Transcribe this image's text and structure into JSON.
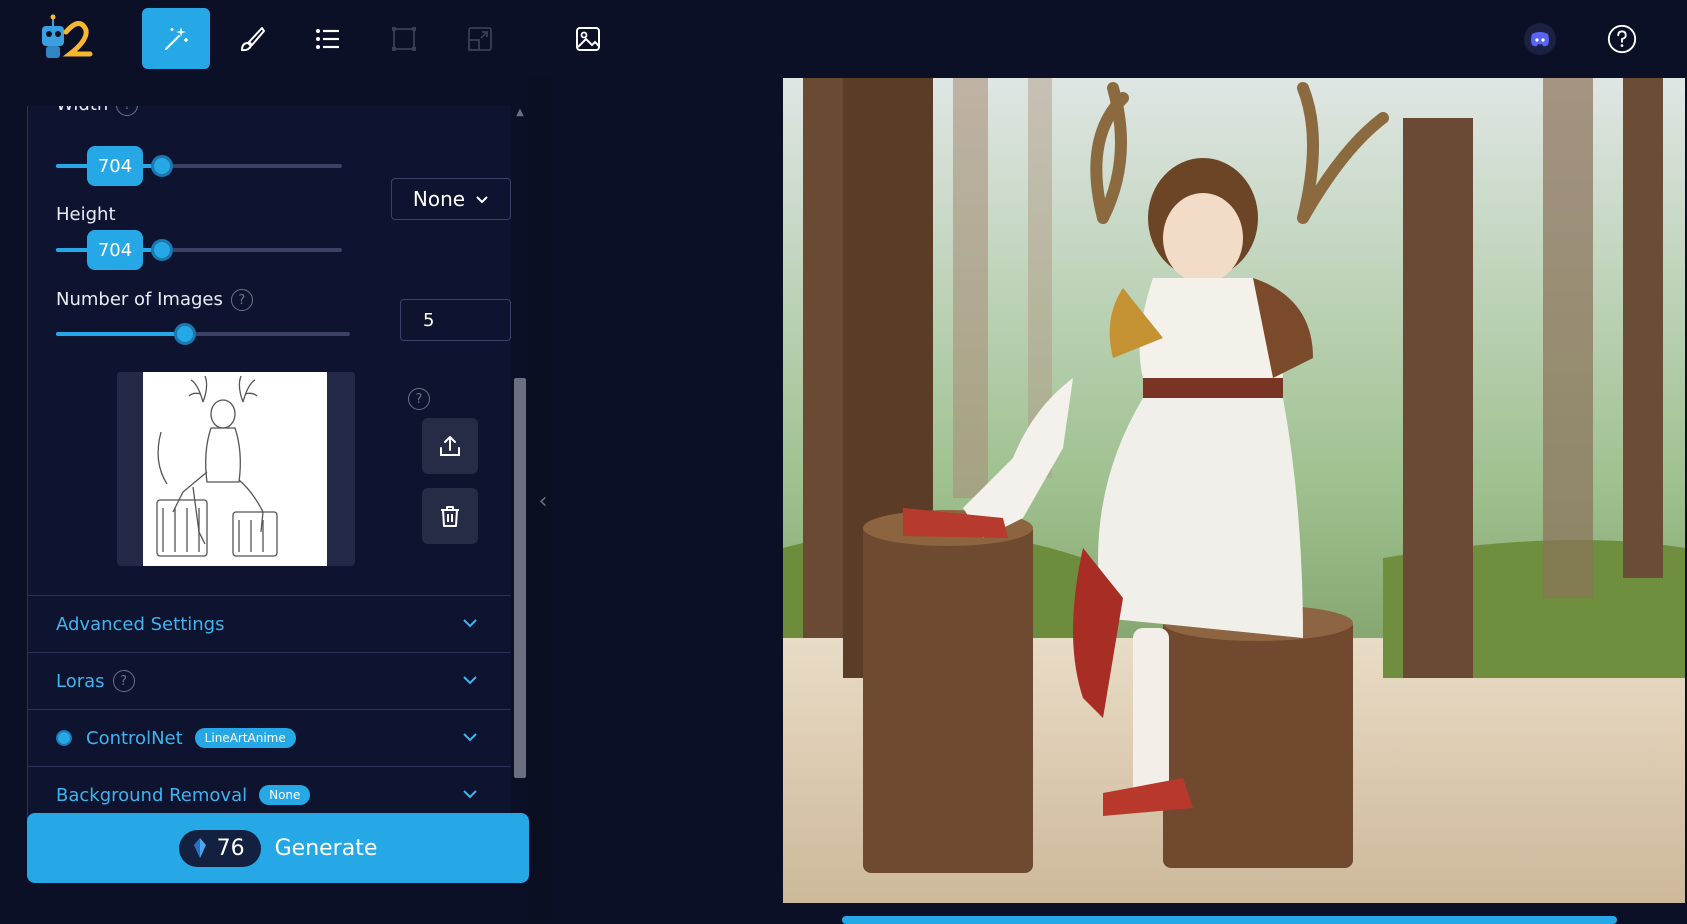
{
  "toolbar": {
    "tools": [
      {
        "name": "generate",
        "icon": "magic-wand-icon",
        "active": true
      },
      {
        "name": "inpaint",
        "icon": "brush-icon"
      },
      {
        "name": "queue",
        "icon": "list-icon"
      },
      {
        "name": "crop",
        "icon": "crop-frame-icon",
        "disabled": true
      },
      {
        "name": "resize",
        "icon": "resize-icon",
        "disabled": true
      },
      {
        "name": "gallery",
        "icon": "image-icon"
      }
    ],
    "right_icons": [
      "discord-icon",
      "help-circle-icon"
    ]
  },
  "settings": {
    "width": {
      "label": "Width",
      "value": "704",
      "level": 0.37
    },
    "height": {
      "label": "Height",
      "value": "704",
      "level": 0.37
    },
    "aspect_select": {
      "value": "None"
    },
    "num_images": {
      "label": "Number of Images",
      "value": "5",
      "level": 0.44
    },
    "help_symbol": "?"
  },
  "accordions": {
    "advanced": {
      "label": "Advanced Settings"
    },
    "loras": {
      "label": "Loras"
    },
    "controlnet": {
      "label": "ControlNet",
      "tag": "LineArtAnime"
    },
    "bg_removal": {
      "label": "Background Removal",
      "tag": "None"
    }
  },
  "generate": {
    "credits": "76",
    "label": "Generate"
  },
  "colors": {
    "accent": "#26a8e6",
    "background": "#0b1026",
    "panel": "#0e1430"
  }
}
